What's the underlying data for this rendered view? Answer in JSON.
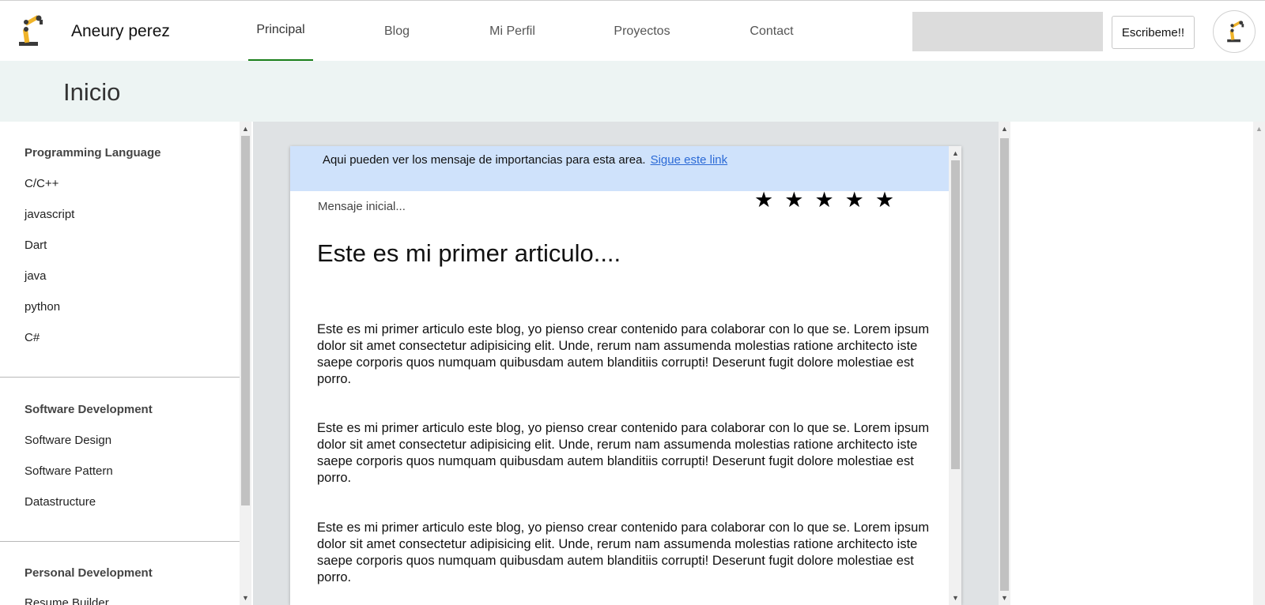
{
  "header": {
    "brand": "Aneury perez",
    "nav": [
      {
        "label": "Principal",
        "active": true
      },
      {
        "label": "Blog",
        "active": false
      },
      {
        "label": "Mi Perfil",
        "active": false
      },
      {
        "label": "Proyectos",
        "active": false
      },
      {
        "label": "Contact",
        "active": false
      }
    ],
    "search_value": "",
    "write_button": "Escribeme!!",
    "icons": {
      "logo": "robot-arm-icon",
      "avatar": "robot-arm-icon"
    },
    "active_color": "#1a7f1a"
  },
  "page": {
    "title": "Inicio"
  },
  "sidebar": {
    "sections": [
      {
        "title": "Programming Language",
        "items": [
          "C/C++",
          "javascript",
          "Dart",
          "java",
          "python",
          "C#"
        ]
      },
      {
        "title": "Software Development",
        "items": [
          "Software Design",
          "Software Pattern",
          "Datastructure"
        ]
      },
      {
        "title": "Personal Development",
        "items": [
          "Resume Builder"
        ]
      }
    ]
  },
  "article": {
    "notice_text": "Aqui pueden ver los mensaje de importancias para esta area.",
    "notice_link": "Sigue este link",
    "initial_message": "Mensaje inicial...",
    "rating_stars": 5,
    "star_glyph": "★",
    "title": "Este es mi primer articulo....",
    "paragraphs": [
      "Este es mi primer articulo este blog, yo pienso crear contenido para colaborar con lo que se. Lorem ipsum dolor sit amet consectetur adipisicing elit. Unde, rerum nam assumenda molestias ratione architecto iste saepe corporis quos numquam quibusdam autem blanditiis corrupti! Deserunt fugit dolore molestiae est porro.",
      "Este es mi primer articulo este blog, yo pienso crear contenido para colaborar con lo que se. Lorem ipsum dolor sit amet consectetur adipisicing elit. Unde, rerum nam assumenda molestias ratione architecto iste saepe corporis quos numquam quibusdam autem blanditiis corrupti! Deserunt fugit dolore molestiae est porro.",
      "Este es mi primer articulo este blog, yo pienso crear contenido para colaborar con lo que se. Lorem ipsum dolor sit amet consectetur adipisicing elit. Unde, rerum nam assumenda molestias ratione architecto iste saepe corporis quos numquam quibusdam autem blanditiis corrupti! Deserunt fugit dolore molestiae est porro."
    ],
    "notice_bg": "#cfe2fb",
    "link_color": "#2b6ad6"
  }
}
